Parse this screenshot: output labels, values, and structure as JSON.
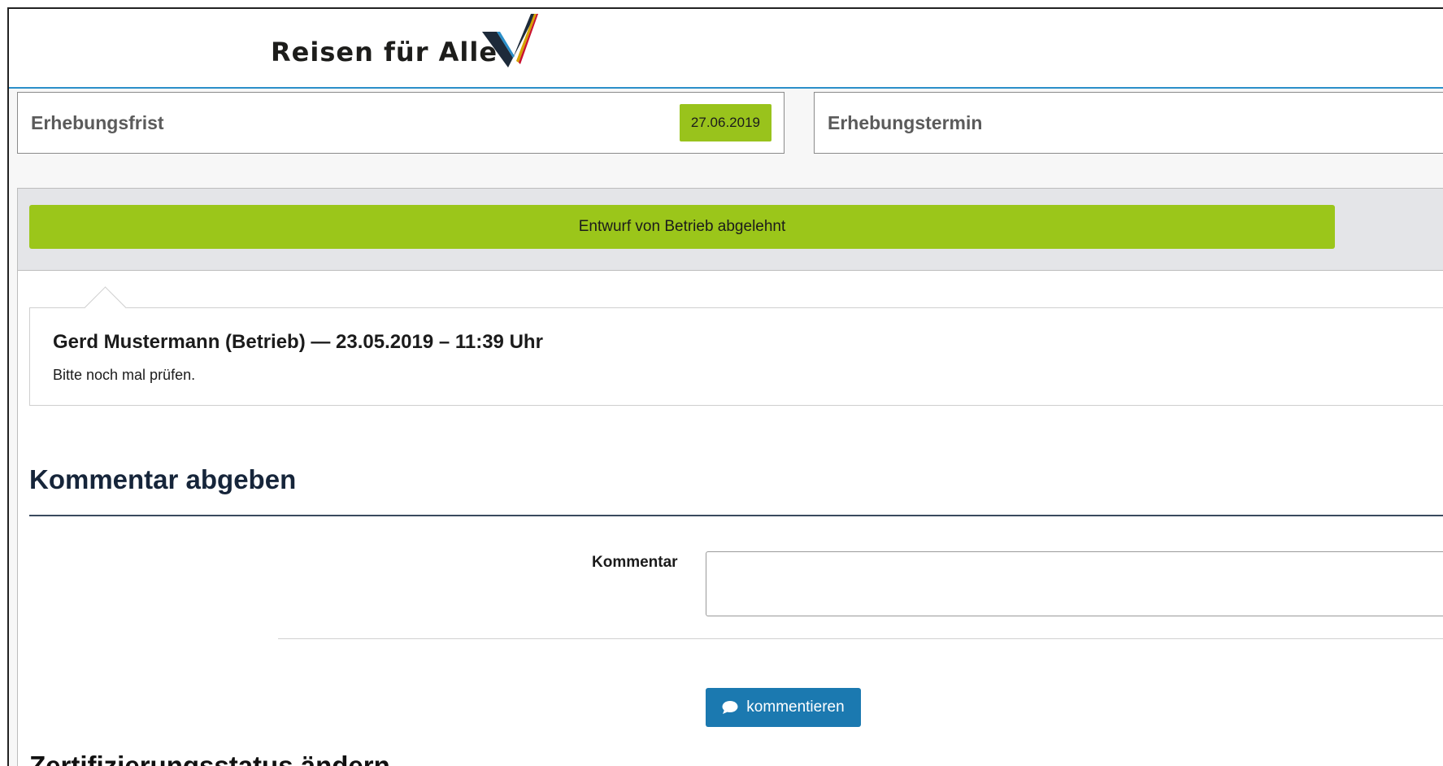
{
  "header": {
    "logo_text": "Reisen für Alle"
  },
  "info": {
    "deadline_label": "Erhebungsfrist",
    "deadline_value": "27.06.2019",
    "appointment_label": "Erhebungstermin"
  },
  "status": {
    "label": "Entwurf von Betrieb abgelehnt",
    "color": "#9bc61a"
  },
  "comments": [
    {
      "author_line": "Gerd Mustermann (Betrieb) — 23.05.2019 – 11:39 Uhr",
      "text": "Bitte noch mal prüfen."
    }
  ],
  "comment_form": {
    "title": "Kommentar abgeben",
    "field_label": "Kommentar",
    "field_value": "",
    "submit_label": "kommentieren",
    "submit_icon": "speech-bubble-icon"
  },
  "next_section": {
    "title": "Zertifizierungsstatus ändern"
  },
  "colors": {
    "accent_green": "#99c31c",
    "button_blue": "#1b79b0",
    "header_rule": "#2b8fc9"
  }
}
